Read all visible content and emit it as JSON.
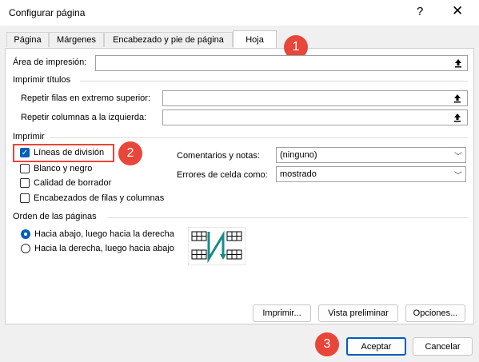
{
  "window": {
    "title": "Configurar página",
    "help": "?",
    "close": "✕"
  },
  "tabs": [
    {
      "label": "Página"
    },
    {
      "label": "Márgenes"
    },
    {
      "label": "Encabezado y pie de página"
    },
    {
      "label": "Hoja"
    }
  ],
  "print_area": {
    "label": "Área de impresión:",
    "value": ""
  },
  "print_titles": {
    "group": "Imprimir títulos",
    "rows_label": "Repetir filas en extremo superior:",
    "cols_label": "Repetir columnas a la izquierda:"
  },
  "print": {
    "group": "Imprimir",
    "gridlines": {
      "label": "Líneas de división",
      "checked": true
    },
    "bw": {
      "label": "Blanco y negro"
    },
    "draft": {
      "label": "Calidad de borrador"
    },
    "headings": {
      "label": "Encabezados de filas y columnas"
    },
    "comments_label": "Comentarios y notas:",
    "comments_value": "(ninguno)",
    "errors_label": "Errores de celda como:",
    "errors_value": "mostrado"
  },
  "order": {
    "group": "Orden de las páginas",
    "down_then_over": "Hacia abajo, luego hacia la derecha",
    "over_then_down": "Hacia la derecha, luego hacia abajo",
    "selected": "down_then_over"
  },
  "buttons": {
    "print": "Imprimir...",
    "preview": "Vista preliminar",
    "options": "Opciones...",
    "ok": "Aceptar",
    "cancel": "Cancelar"
  },
  "badges": [
    "1",
    "2",
    "3"
  ],
  "colors": {
    "accent": "#005fb8",
    "badge": "#e8463a",
    "arrow": "#1a8a8a"
  }
}
